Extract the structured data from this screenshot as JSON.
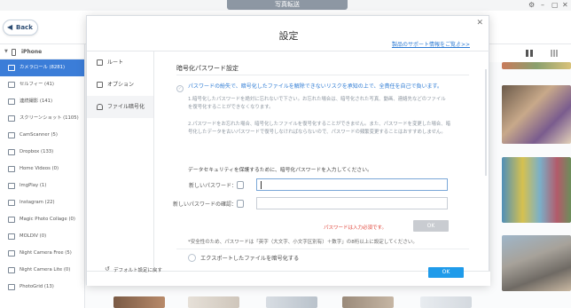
{
  "window": {
    "title": "写真転送"
  },
  "header": {
    "back_label": "Back"
  },
  "sidebar": {
    "device": "iPhone",
    "items": [
      {
        "label": "カメラロール (8281)",
        "active": true
      },
      {
        "label": "セルフィー (41)"
      },
      {
        "label": "連続撮影 (141)"
      },
      {
        "label": "スクリーンショット (1105)"
      },
      {
        "label": "CamScanner (5)"
      },
      {
        "label": "Dropbox (133)"
      },
      {
        "label": "Home Videos (0)"
      },
      {
        "label": "ImgPlay (1)"
      },
      {
        "label": "Instagram (22)"
      },
      {
        "label": "Magic Photo Collage (0)"
      },
      {
        "label": "MOLDIV (0)"
      },
      {
        "label": "Night Camera Free (5)"
      },
      {
        "label": "Night Camera Lite (0)"
      },
      {
        "label": "PhotoGrid (13)"
      }
    ]
  },
  "dialog": {
    "title": "設定",
    "support_link": "製品のサポート情報をご覧ゟ>>",
    "nav": [
      {
        "label": "ルート"
      },
      {
        "label": "オプション"
      },
      {
        "label": "ファイル暗号化",
        "active": true
      }
    ],
    "section_title": "暗号化パスワード設定",
    "warning": "パスワードの紛失で、暗号化したファイルを解除できないリスクを承知の上で、全責任を自己で負います。",
    "note1_a": "1.暗号化したパスワードを絶対に忘れないで下さい。お忘れた場合は、暗号化された写真、動画、連絡先などのファイル",
    "note1_b": "を復号化することができなくなります。",
    "note2_a": "2.パスワードをお忘れた場合、暗号化したファイルを復号化することができません。また、パスワードを変更した場合、暗",
    "note2_b": "号化したデータを古いパスワードで復号しなければならないので、パスワードの頻繁変更することはおすすめしません。",
    "prompt": "データセキュリティを保護するために、暗号化パスワードを入力してください。",
    "new_password_label": "新しいパスワード：",
    "confirm_password_label": "新しいパスワードの確認：",
    "error": "パスワードは入力必須です。",
    "ok_inner": "OK",
    "hint": "*安全性のため、パスワードは「英字（大文字、小文字区別有）＋数字」の8桁以上に設定してください。",
    "export_encrypt": "エクスポートしたファイルを暗号化する",
    "reset_label": "デフォルト設定に戻す",
    "ok_label": "OK"
  },
  "colors": {
    "accent": "#1f9bea",
    "active_sidebar": "#3b7dd8",
    "error": "#e0453a",
    "link": "#2d7bd4",
    "scroll": "#f2a93b"
  }
}
